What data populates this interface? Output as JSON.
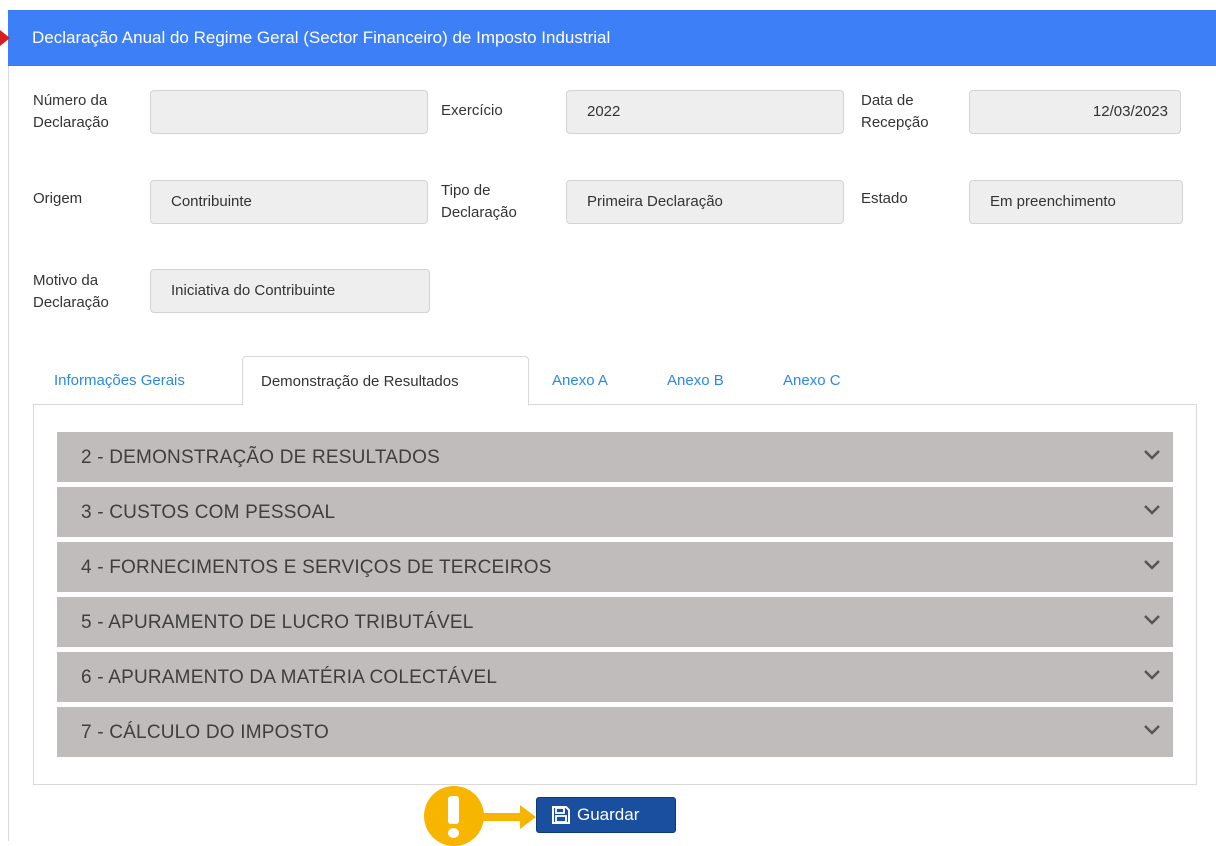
{
  "header": {
    "title": "Declaração Anual do Regime Geral (Sector Financeiro) de Imposto Industrial"
  },
  "form": {
    "numero_label": "Número da Declaração",
    "numero_value": "",
    "exercicio_label": "Exercício",
    "exercicio_value": "2022",
    "data_label": "Data de Recepção",
    "data_value": "12/03/2023",
    "origem_label": "Origem",
    "origem_value": "Contribuinte",
    "tipo_label": "Tipo de Declaração",
    "tipo_value": "Primeira Declaração",
    "estado_label": "Estado",
    "estado_value": "Em preenchimento",
    "motivo_label": "Motivo da Declaração",
    "motivo_value": "Iniciativa do Contribuinte"
  },
  "tabs": [
    {
      "label": "Informações Gerais",
      "active": false
    },
    {
      "label": "Demonstração de Resultados",
      "active": true
    },
    {
      "label": "Anexo A",
      "active": false
    },
    {
      "label": "Anexo B",
      "active": false
    },
    {
      "label": "Anexo C",
      "active": false
    }
  ],
  "sections": [
    {
      "label": "2 - DEMONSTRAÇÃO DE RESULTADOS"
    },
    {
      "label": "3 - CUSTOS COM PESSOAL"
    },
    {
      "label": "4 - FORNECIMENTOS E SERVIÇOS DE TERCEIROS"
    },
    {
      "label": "5 - APURAMENTO DE LUCRO TRIBUTÁVEL"
    },
    {
      "label": "6 - APURAMENTO DA MATÉRIA COLECTÁVEL"
    },
    {
      "label": "7 - CÁLCULO DO IMPOSTO"
    }
  ],
  "actions": {
    "save_label": "Guardar"
  },
  "colors": {
    "header_bg": "#3d7ff6",
    "accordion_bg": "#c1bcbc",
    "tab_link": "#2a8ae0",
    "save_button": "#1a4e9e",
    "warning": "#f7b500",
    "header_marker": "#d42020"
  },
  "icons": {
    "chevron": "chevron-down-icon",
    "save": "floppy-disk-icon",
    "warning": "exclamation-icon"
  }
}
